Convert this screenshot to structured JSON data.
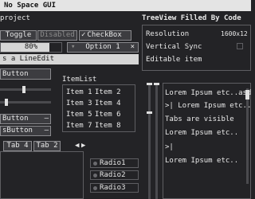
{
  "window": {
    "title": "No Space GUI"
  },
  "project": {
    "title": "project"
  },
  "toolbar": {
    "toggle_label": "Toggle",
    "disabled_label": "Disabled",
    "checkbox_label": "CheckBox",
    "checkbox_mark": "✓"
  },
  "progress": {
    "value_label": "80%",
    "value_percent": 80
  },
  "dropdown": {
    "selected": "Option 1",
    "arrow": "▾",
    "clear": "×"
  },
  "lineedit": {
    "value": "s a LineEdit"
  },
  "button": {
    "label": "Button"
  },
  "spinbuttons": [
    {
      "label": "Button",
      "value": "—"
    },
    {
      "label": "sButton",
      "value": "—"
    }
  ],
  "itemlist": {
    "title": "ItemList",
    "items": [
      "Item 1",
      "Item 2",
      "Item 3",
      "Item 4",
      "Item 5",
      "Item 6",
      "Item 7",
      "Item 8"
    ]
  },
  "tabs": {
    "labels": [
      "Tab 4",
      "Tab 2"
    ],
    "prev": "◀",
    "next": "▶"
  },
  "radios": [
    "Radio1",
    "Radio2",
    "Radio3"
  ],
  "treeview": {
    "title": "TreeView Filled By Code",
    "rows": [
      {
        "label": "Resolution",
        "value": "1600x12"
      },
      {
        "label": "Vertical Sync",
        "value": ""
      },
      {
        "label": "Editable item",
        "value": ""
      }
    ]
  },
  "tabpanel": {
    "lines": [
      "Lorem Ipsum etc..asd",
      ">|   Lorem Ipsum etc..",
      "Tabs are visible",
      "Lorem Ipsum etc..",
      ">|",
      "Lorem Ipsum etc.."
    ]
  },
  "colors": {
    "background": "#232326",
    "panel_border": "#5e5e62",
    "text": "#e8e8e8",
    "accent_light": "#d6d6d6"
  }
}
